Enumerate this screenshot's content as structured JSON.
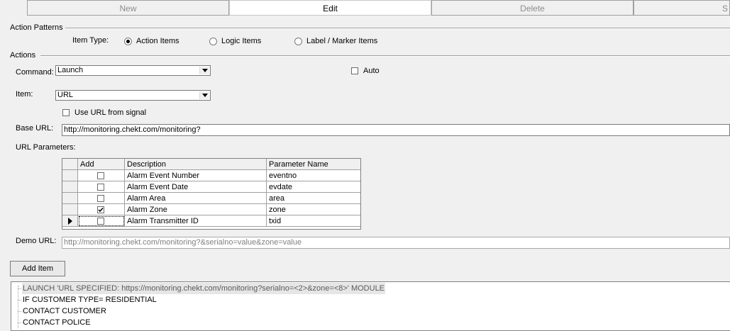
{
  "toolbar": {
    "buttons": [
      {
        "label": "New"
      },
      {
        "label": "Edit"
      },
      {
        "label": "Delete"
      },
      {
        "label": "S"
      }
    ]
  },
  "action_patterns": {
    "group_label": "Action Patterns",
    "item_type_label": "Item Type:",
    "options": [
      {
        "label": "Action Items",
        "selected": true
      },
      {
        "label": "Logic Items",
        "selected": false
      },
      {
        "label": "Label / Marker Items",
        "selected": false
      }
    ]
  },
  "actions": {
    "group_label": "Actions",
    "command_label": "Command:",
    "command_value": "Launch",
    "auto_label": "Auto",
    "auto_checked": false,
    "item_label": "Item:",
    "item_value": "URL",
    "use_url_label": "Use URL from signal",
    "use_url_checked": false,
    "base_url_label": "Base URL:",
    "base_url_value": "http://monitoring.chekt.com/monitoring?",
    "url_params_label": "URL Parameters:",
    "params_table": {
      "headers": [
        "Add",
        "Description",
        "Parameter Name"
      ],
      "rows": [
        {
          "checked": false,
          "description": "Alarm Event Number",
          "param": "eventno"
        },
        {
          "checked": false,
          "description": "Alarm Event Date",
          "param": "evdate"
        },
        {
          "checked": false,
          "description": "Alarm Area",
          "param": "area"
        },
        {
          "checked": true,
          "description": "Alarm Zone",
          "param": "zone"
        },
        {
          "checked": false,
          "description": "Alarm Transmitter ID",
          "param": "txid"
        }
      ]
    },
    "demo_url_label": "Demo URL:",
    "demo_url_value": "http://monitoring.chekt.com/monitoring?&serialno=value&zone=value",
    "add_item_label": "Add Item"
  },
  "tree": {
    "items": [
      "LAUNCH 'URL SPECIFIED: https://monitoring.chekt.com/monitoring?serialno=<2>&zone=<8>' MODULE",
      "IF CUSTOMER TYPE= RESIDENTIAL",
      "CONTACT CUSTOMER",
      "CONTACT POLICE"
    ]
  }
}
